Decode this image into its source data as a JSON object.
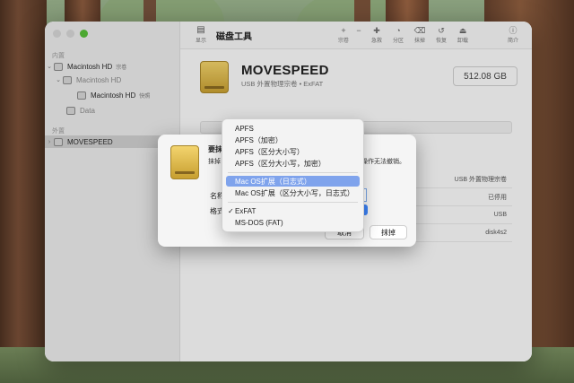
{
  "window": {
    "app_title": "磁盘工具",
    "sidebar": {
      "section_internal": "内置",
      "section_external": "外置",
      "items": [
        {
          "label": "Macintosh HD",
          "sub": "宗卷"
        },
        {
          "label": "Macintosh HD",
          "sub": ""
        },
        {
          "label": "Macintosh HD",
          "sub": "快照"
        },
        {
          "label": "Data",
          "sub": ""
        },
        {
          "label": "MOVESPEED",
          "sub": ""
        }
      ]
    },
    "toolbar": {
      "view_label": "显示",
      "buttons": [
        {
          "glyph": "+",
          "label": "宗卷"
        },
        {
          "glyph": "−",
          "label": ""
        },
        {
          "glyph": "✚",
          "label": "急救"
        },
        {
          "glyph": "◔",
          "label": "分区"
        },
        {
          "glyph": "⌫",
          "label": "抹掉"
        },
        {
          "glyph": "↺",
          "label": "恢复"
        },
        {
          "glyph": "⏏",
          "label": "卸载"
        },
        {
          "glyph": "ⓘ",
          "label": "简介"
        }
      ]
    },
    "volume": {
      "name": "MOVESPEED",
      "subtitle": "USB 外置物理宗卷 • ExFAT",
      "capacity": "512.08 GB"
    },
    "info_rows": [
      "USB 外置物理宗卷",
      "已停用",
      "USB",
      "disk4s2"
    ]
  },
  "sheet": {
    "title": "要抹",
    "text_left": "抹掉",
    "text_right": "操作无法撤销。",
    "name_label": "名称",
    "format_label": "格式",
    "cancel_label": "取消",
    "erase_label": "抹掉"
  },
  "format_menu": {
    "items": [
      {
        "label": "APFS",
        "checked": false,
        "highlighted": false
      },
      {
        "label": "APFS（加密）",
        "checked": false,
        "highlighted": false
      },
      {
        "label": "APFS（区分大小写）",
        "checked": false,
        "highlighted": false
      },
      {
        "label": "APFS（区分大小写，加密）",
        "checked": false,
        "highlighted": false
      },
      {
        "label": "Mac OS扩展（日志式）",
        "checked": false,
        "highlighted": true
      },
      {
        "label": "Mac OS扩展（区分大小写，日志式）",
        "checked": false,
        "highlighted": false
      },
      {
        "label": "ExFAT",
        "checked": true,
        "highlighted": false
      },
      {
        "label": "MS-DOS (FAT)",
        "checked": false,
        "highlighted": false
      }
    ],
    "check_glyph": "✓"
  },
  "colors": {
    "highlight": "#7fa3ec",
    "traffic_close": "#d6d6d6",
    "traffic_min": "#d6d6d6",
    "traffic_zoom": "#57c038",
    "volume_icon": "#e0b845"
  }
}
